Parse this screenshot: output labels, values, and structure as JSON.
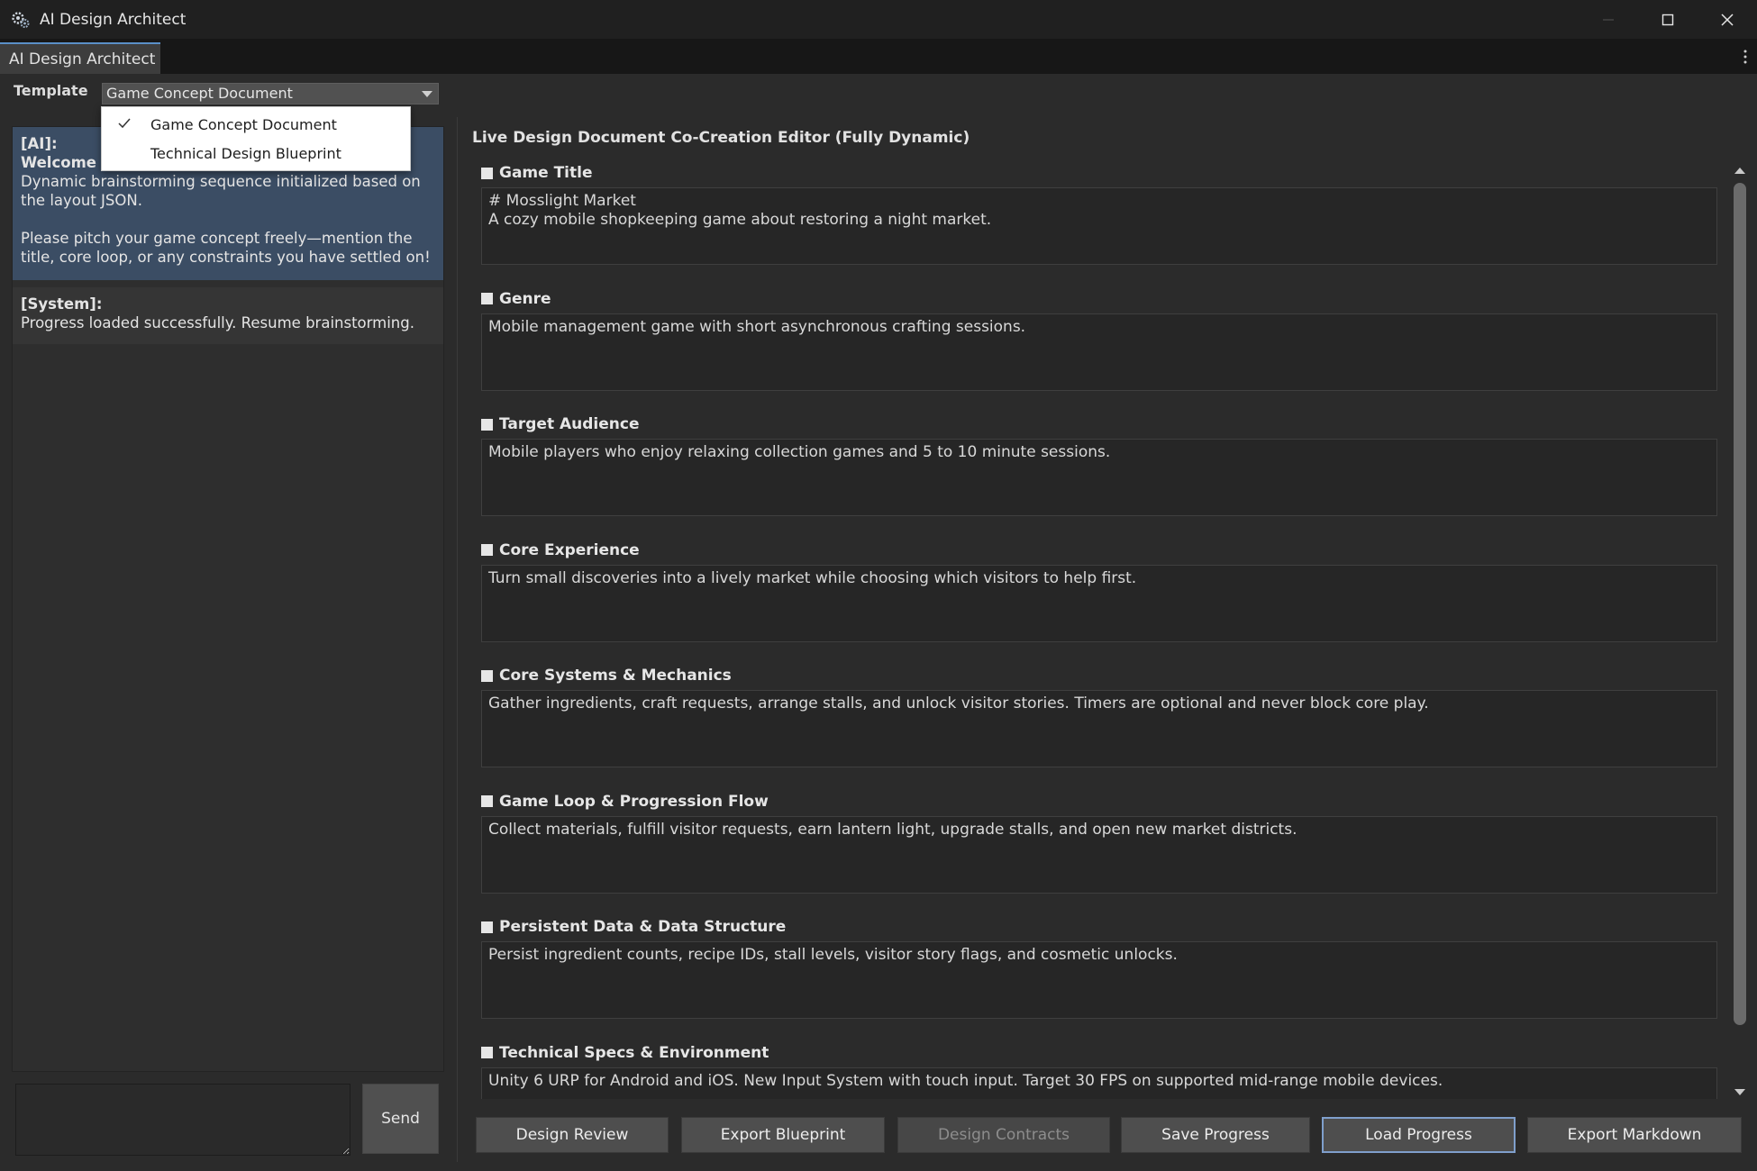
{
  "window": {
    "title": "AI Design Architect",
    "app_icon": "gear-cluster-icon"
  },
  "tab": {
    "label": "AI Design Architect"
  },
  "template": {
    "label": "Template",
    "selected": "Game Concept Document",
    "options": [
      "Game Concept Document",
      "Technical Design Blueprint"
    ]
  },
  "chat": {
    "ai_sender": "[AI]:",
    "ai_welcome": "Welcome t",
    "ai_line1": "Dynamic brainstorming sequence initialized based on the layout JSON.",
    "ai_line2": "Please pitch your game concept freely—mention the title, core loop, or any constraints you have settled on!",
    "system_sender": "[System]:",
    "system_text": "Progress loaded successfully. Resume brainstorming.",
    "input_value": "",
    "send_label": "Send"
  },
  "editor": {
    "title": "Live Design Document Co-Creation Editor (Fully Dynamic)",
    "sections": [
      {
        "heading": "Game Title",
        "content": "# Mosslight Market\nA cozy mobile shopkeeping game about restoring a night market."
      },
      {
        "heading": "Genre",
        "content": "Mobile management game with short asynchronous crafting sessions."
      },
      {
        "heading": "Target Audience",
        "content": "Mobile players who enjoy relaxing collection games and 5 to 10 minute sessions."
      },
      {
        "heading": "Core Experience",
        "content": "Turn small discoveries into a lively market while choosing which visitors to help first."
      },
      {
        "heading": "Core Systems & Mechanics",
        "content": "Gather ingredients, craft requests, arrange stalls, and unlock visitor stories. Timers are optional and never block core play."
      },
      {
        "heading": "Game Loop & Progression Flow",
        "content": "Collect materials, fulfill visitor requests, earn lantern light, upgrade stalls, and open new market districts."
      },
      {
        "heading": "Persistent Data & Data Structure",
        "content": "Persist ingredient counts, recipe IDs, stall levels, visitor story flags, and cosmetic unlocks."
      },
      {
        "heading": "Technical Specs & Environment",
        "content": "Unity 6 URP for Android and iOS. New Input System with touch input. Target 30 FPS on supported mid-range mobile devices."
      }
    ]
  },
  "actions": {
    "design_review": "Design Review",
    "export_blueprint": "Export Blueprint",
    "design_contracts": "Design Contracts",
    "save_progress": "Save Progress",
    "load_progress": "Load Progress",
    "export_markdown": "Export Markdown"
  }
}
